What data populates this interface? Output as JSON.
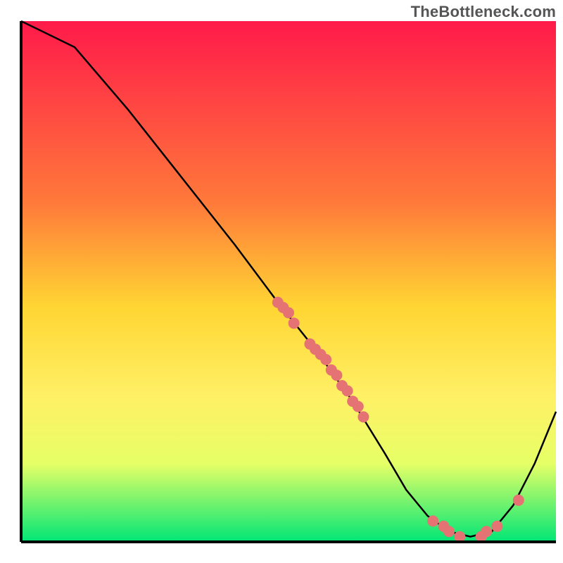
{
  "watermark": "TheBottleneck.com",
  "chart_data": {
    "type": "line",
    "title": "",
    "xlabel": "",
    "ylabel": "",
    "xlim": [
      0,
      100
    ],
    "ylim": [
      0,
      100
    ],
    "series": [
      {
        "name": "curve",
        "x": [
          0,
          4,
          10,
          20,
          30,
          40,
          48,
          55,
          62,
          68,
          72,
          76,
          80,
          84,
          88,
          92,
          96,
          100
        ],
        "values": [
          100,
          98,
          95,
          83,
          70,
          57,
          46,
          37,
          27,
          17,
          10,
          5,
          2,
          1,
          2,
          7,
          15,
          25
        ]
      }
    ],
    "scatter_points": {
      "name": "markers",
      "x": [
        48,
        49,
        50,
        51,
        54,
        55,
        56,
        57,
        58,
        59,
        60,
        61,
        62,
        63,
        64,
        77,
        79,
        80,
        82,
        86,
        87,
        89,
        93
      ],
      "values": [
        46,
        45,
        44,
        42,
        38,
        37,
        36,
        35,
        33,
        32,
        30,
        29,
        27,
        26,
        24,
        4,
        3,
        2,
        1,
        1,
        2,
        3,
        8
      ]
    },
    "gradient_colors": {
      "top": "#ff1a4a",
      "mid1": "#ff7a3a",
      "mid2": "#ffd633",
      "mid3": "#fff066",
      "mid4": "#e6ff66",
      "bottom": "#00e676"
    },
    "curve_color": "#000000",
    "marker_color": "#e57373",
    "axis_color": "#000000"
  }
}
